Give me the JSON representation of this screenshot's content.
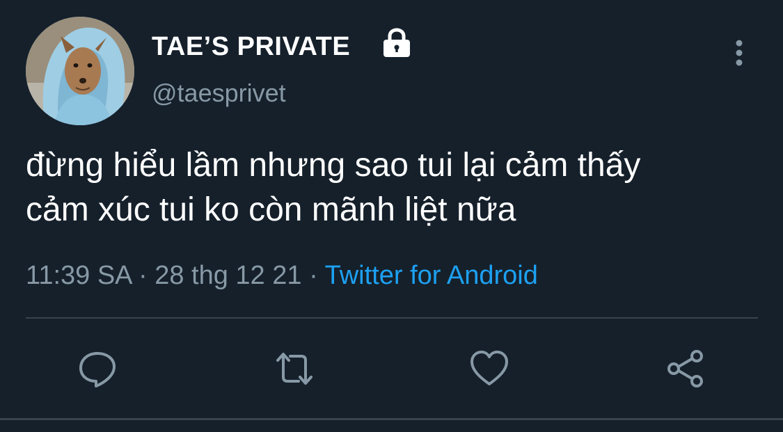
{
  "tweet": {
    "display_name": "TAE’S PRIVATE",
    "handle": "@taesprivet",
    "text_line1": "đừng hiểu lầm nhưng sao tui lại cảm thấy",
    "text_line2": "cảm xúc tui ko còn mãnh liệt nữa",
    "time": "11:39 SA",
    "date": "28 thg 12 21",
    "separator": "·",
    "source": "Twitter for Android"
  },
  "icons": {
    "lock": "lock-icon",
    "more": "vertical-dots-icon",
    "reply": "speech-bubble-icon",
    "retweet": "retweet-arrows-icon",
    "like": "heart-icon",
    "share": "share-nodes-icon"
  },
  "colors": {
    "background": "#15202b",
    "text": "#ffffff",
    "secondary": "#8899a6",
    "link": "#1da1f2",
    "divider": "#38444d"
  }
}
